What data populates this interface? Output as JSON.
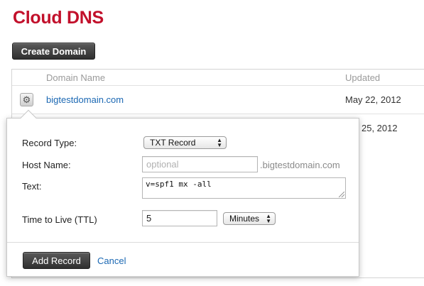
{
  "page": {
    "title": "Cloud DNS",
    "create_button": "Create Domain"
  },
  "table": {
    "headers": {
      "name": "Domain Name",
      "updated": "Updated"
    },
    "rows": [
      {
        "domain": "bigtestdomain.com",
        "updated": "May 22, 2012",
        "icon": "gear-icon"
      },
      {
        "domain": "",
        "updated": "25, 2012",
        "icon": ""
      }
    ]
  },
  "popover": {
    "record_type": {
      "label": "Record Type:",
      "value": "TXT Record"
    },
    "host_name": {
      "label": "Host Name:",
      "placeholder": "optional",
      "value": "",
      "suffix": ".bigtestdomain.com"
    },
    "text": {
      "label": "Text:",
      "value": "v=spf1 mx -all"
    },
    "ttl": {
      "label": "Time to Live (TTL)",
      "value": "5",
      "unit": "Minutes"
    },
    "add_button": "Add Record",
    "cancel_link": "Cancel"
  },
  "colors": {
    "title": "#c2102b",
    "link": "#1b68b3",
    "button": "#3a3a3a"
  }
}
